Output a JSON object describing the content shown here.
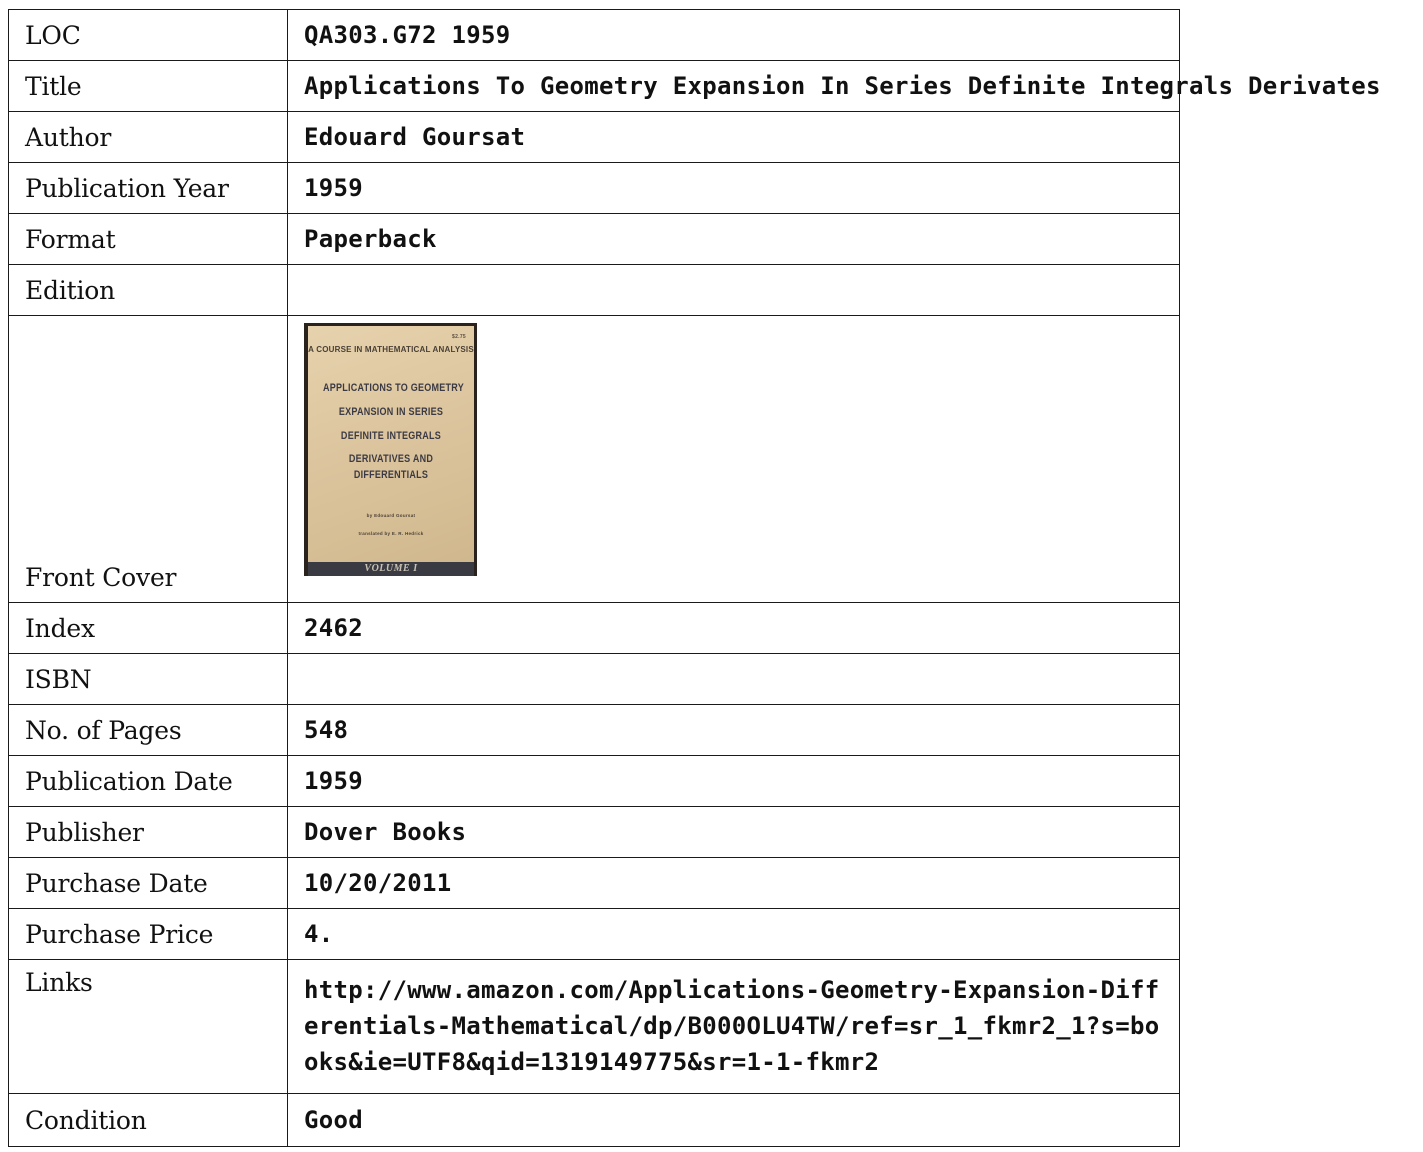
{
  "record": {
    "loc": {
      "label": "LOC",
      "value": "QA303.G72 1959"
    },
    "title": {
      "label": "Title",
      "value": "Applications To Geometry Expansion In Series Definite Integrals Derivates"
    },
    "author": {
      "label": "Author",
      "value": "Edouard Goursat"
    },
    "publication_year": {
      "label": "Publication Year",
      "value": "1959"
    },
    "format": {
      "label": "Format",
      "value": "Paperback"
    },
    "edition": {
      "label": "Edition",
      "value": ""
    },
    "front_cover": {
      "label": "Front Cover",
      "cover": {
        "series": "A COURSE IN MATHEMATICAL ANALYSIS",
        "price": "$2.75",
        "line1": "APPLICATIONS TO GEOMETRY",
        "line2": "EXPANSION IN SERIES",
        "line3": "DEFINITE INTEGRALS",
        "line4": "DERIVATIVES AND",
        "line5": "DIFFERENTIALS",
        "author_line": "by Edouard Goursat",
        "translator_line": "translated by E. R. Hedrick",
        "volume": "VOLUME I"
      }
    },
    "index": {
      "label": "Index",
      "value": "2462"
    },
    "isbn": {
      "label": "ISBN",
      "value": ""
    },
    "pages": {
      "label": "No. of Pages",
      "value": "548"
    },
    "publication_date": {
      "label": "Publication Date",
      "value": "1959"
    },
    "publisher": {
      "label": "Publisher",
      "value": "Dover Books"
    },
    "purchase_date": {
      "label": "Purchase Date",
      "value": "10/20/2011"
    },
    "purchase_price": {
      "label": "Purchase Price",
      "value": "4."
    },
    "links": {
      "label": "Links",
      "value": "http://www.amazon.com/Applications-Geometry-Expansion-Differentials-Mathematical/dp/B000OLU4TW/ref=sr_1_fkmr2_1?s=books&ie=UTF8&qid=1319149775&sr=1-1-fkmr2"
    },
    "condition": {
      "label": "Condition",
      "value": "Good"
    }
  }
}
